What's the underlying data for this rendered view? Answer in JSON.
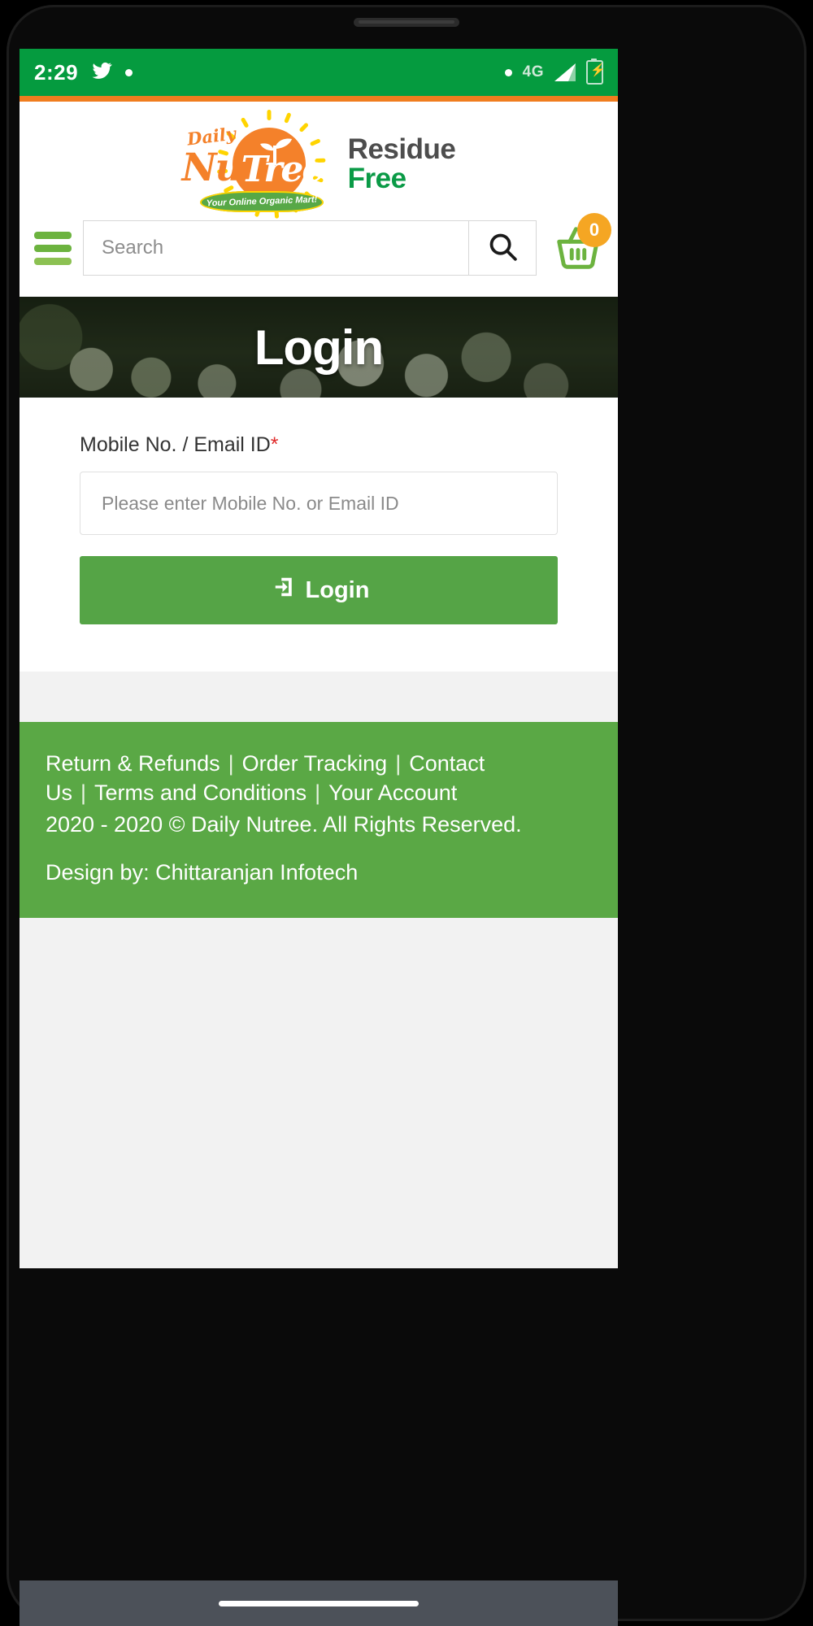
{
  "statusbar": {
    "time": "2:29",
    "twitter_icon": "twitter-bird-icon",
    "dot_icon": "notification-dot-icon",
    "right_dot_icon": "status-dot-icon",
    "network": "4G",
    "signal_icon": "signal-bars-icon",
    "battery_icon": "battery-charging-icon"
  },
  "header": {
    "logo": {
      "daily": "Daily",
      "nu": "Nu",
      "tree": "Tree",
      "tagline": "Your Online Organic Mart!",
      "residue": "Residue",
      "free": "Free"
    },
    "menu_icon": "hamburger-menu-icon",
    "search": {
      "placeholder": "Search",
      "value": "",
      "button_icon": "search-icon"
    },
    "cart": {
      "icon": "shopping-basket-icon",
      "count": "0"
    }
  },
  "hero": {
    "title": "Login"
  },
  "form": {
    "label": "Mobile No. / Email ID",
    "required_marker": "*",
    "input_placeholder": "Please enter Mobile No. or Email ID",
    "input_value": "",
    "submit_label": "Login",
    "submit_icon": "sign-in-arrow-icon"
  },
  "footer": {
    "links": [
      "Return & Refunds",
      "Order Tracking",
      "Contact Us",
      "Terms and Conditions",
      "Your Account"
    ],
    "separator": "|",
    "copyright": "2020 - 2020 © Daily Nutree. All Rights Reserved.",
    "design_by": "Design by: Chittaranjan Infotech"
  },
  "colors": {
    "status_green": "#059b3f",
    "accent_orange": "#f07d1e",
    "brand_orange": "#f4812a",
    "brand_green": "#0a9a46",
    "button_green": "#55a446",
    "footer_green": "#5aa845",
    "badge_orange": "#f5a623",
    "menu_green": "#6cb33f"
  },
  "navbar": {
    "home_indicator": "home-indicator"
  }
}
